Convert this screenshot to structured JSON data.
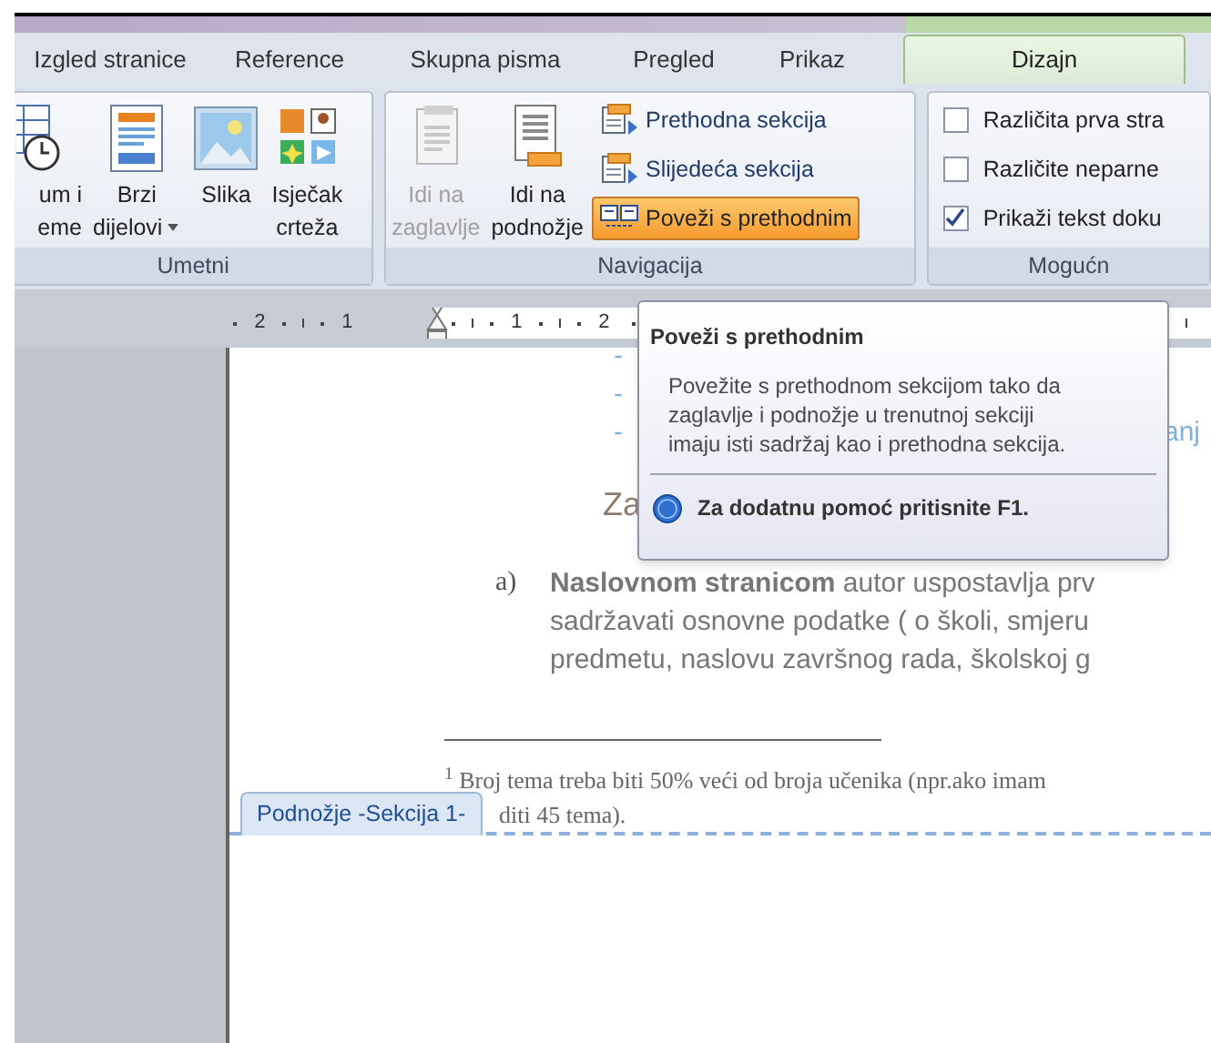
{
  "tabs": [
    {
      "label": "Izgled stranice",
      "selected": false
    },
    {
      "label": "Reference",
      "selected": false
    },
    {
      "label": "Skupna pisma",
      "selected": false
    },
    {
      "label": "Pregled",
      "selected": false
    },
    {
      "label": "Prikaz",
      "selected": false
    },
    {
      "label": "Dizajn",
      "selected": true
    }
  ],
  "ribbon": {
    "groups": [
      {
        "label": "Umetni",
        "buttons": [
          {
            "lines": [
              "um i",
              "eme"
            ],
            "has_menu": false,
            "disabled": false
          },
          {
            "lines": [
              "Brzi",
              "dijelovi"
            ],
            "has_menu": true,
            "disabled": false
          },
          {
            "lines": [
              "Slika"
            ],
            "has_menu": false,
            "disabled": false
          },
          {
            "lines": [
              "Isječak",
              "crteža"
            ],
            "has_menu": false,
            "disabled": false
          }
        ]
      },
      {
        "label": "Navigacija",
        "buttons": [
          {
            "lines": [
              "Idi na",
              "zaglavlje"
            ],
            "has_menu": false,
            "disabled": true
          },
          {
            "lines": [
              "Idi na",
              "podnožje"
            ],
            "has_menu": false,
            "disabled": false
          }
        ],
        "small_buttons": [
          {
            "label": "Prethodna sekcija",
            "selected": false
          },
          {
            "label": "Slijedeća sekcija",
            "selected": false
          },
          {
            "label": "Poveži s prethodnim",
            "selected": true
          }
        ]
      },
      {
        "label": "Mogućn",
        "checkboxes": [
          {
            "label": "Različita prva stra",
            "checked": false
          },
          {
            "label": "Različite neparne",
            "checked": false
          },
          {
            "label": "Prikaži tekst doku",
            "checked": true
          }
        ]
      }
    ]
  },
  "ruler": {
    "left_numbers": [
      "2",
      "1"
    ],
    "right_numbers": [
      "1",
      "2"
    ]
  },
  "tooltip": {
    "title": "Poveži s prethodnim",
    "body": "Povežite s prethodnom sekcijom tako da zaglavlje i podnožje u trenutnoj sekciji imaju isti sadržaj kao i prethodna sekcija.",
    "help": "Za dodatnu pomoć pritisnite F1."
  },
  "document": {
    "bullets": [
      {
        "marker": "-"
      },
      {
        "marker": "-"
      },
      {
        "marker": "-",
        "text": "anj"
      }
    ],
    "heading": "Za",
    "list_item": {
      "marker": "a)",
      "lines": [
        "**Naslovnom stranicom**  autor uspostavlja prv",
        "sadržavati osnovne podatke ( o školi, smjeru",
        "predmetu, naslovu završnog rada, školskoj g"
      ]
    },
    "footnote": {
      "lines": [
        "$^{1}$ Broj tema treba biti 50% veći od broja učenika (npr.ako imam",
        "diti 45 tema)."
      ]
    },
    "footer_tab": "Podnožje -Sekcija 1-"
  }
}
